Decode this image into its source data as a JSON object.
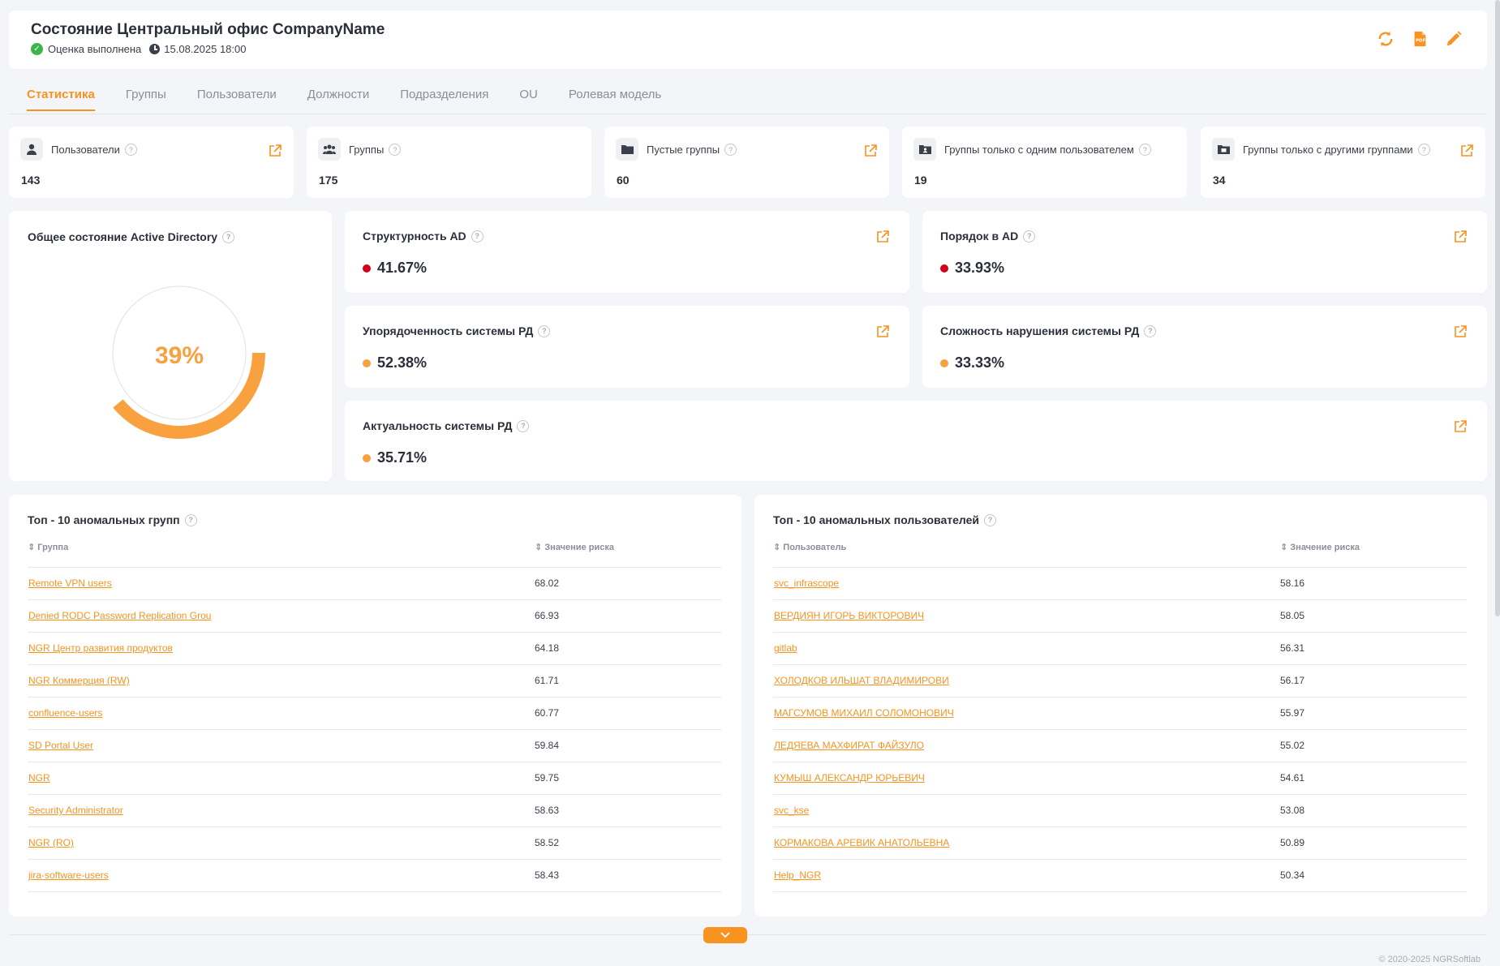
{
  "header": {
    "title": "Состояние Центральный офис CompanyName",
    "status": "Оценка выполнена",
    "datetime": "15.08.2025 18:00",
    "icons": [
      "refresh-icon",
      "pdf-export-icon",
      "edit-icon"
    ]
  },
  "tabs": [
    {
      "label": "Статистика",
      "active": true
    },
    {
      "label": "Группы"
    },
    {
      "label": "Пользователи"
    },
    {
      "label": "Должности"
    },
    {
      "label": "Подразделения"
    },
    {
      "label": "OU"
    },
    {
      "label": "Ролевая модель"
    }
  ],
  "stats": [
    {
      "label": "Пользователи",
      "value": "143",
      "icon": "user-icon",
      "link": true
    },
    {
      "label": "Группы",
      "value": "175",
      "icon": "group-icon",
      "link": false
    },
    {
      "label": "Пустые группы",
      "value": "60",
      "icon": "folder-icon",
      "link": true
    },
    {
      "label": "Группы только с одним пользователем",
      "value": "19",
      "icon": "folder-user-icon",
      "link": false
    },
    {
      "label": "Группы только с другими группами",
      "value": "34",
      "icon": "folder-group-icon",
      "link": true
    }
  ],
  "overall": {
    "title": "Общее состояние Active Directory",
    "value": "39%",
    "fraction": 0.39,
    "color": "#f9a03f"
  },
  "metrics": {
    "structure": {
      "title": "Структурность AD",
      "value": "41.67%",
      "status_color": "#d0021b"
    },
    "order": {
      "title": "Порядок в AD",
      "value": "33.93%",
      "status_color": "#d0021b"
    },
    "rd_order": {
      "title": "Упорядоченность системы РД",
      "value": "52.38%",
      "status_color": "#f9a03f"
    },
    "rd_violation": {
      "title": "Сложность нарушения системы РД",
      "value": "33.33%",
      "status_color": "#f9a03f"
    },
    "rd_actuality": {
      "title": "Актуальность системы РД",
      "value": "35.71%",
      "status_color": "#f9a03f"
    }
  },
  "top_groups": {
    "title": "Топ - 10 аномальных групп",
    "columns": [
      "Группа",
      "Значение риска"
    ],
    "rows": [
      [
        "Remote VPN users",
        "68.02"
      ],
      [
        "Denied RODC Password Replication Grou",
        "66.93"
      ],
      [
        "NGR Центр развития продуктов",
        "64.18"
      ],
      [
        "NGR Коммерция (RW)",
        "61.71"
      ],
      [
        "confluence-users",
        "60.77"
      ],
      [
        "SD Portal User",
        "59.84"
      ],
      [
        "NGR",
        "59.75"
      ],
      [
        "Security Administrator",
        "58.63"
      ],
      [
        "NGR (RO)",
        "58.52"
      ],
      [
        "jira-software-users",
        "58.43"
      ]
    ]
  },
  "top_users": {
    "title": "Топ - 10 аномальных пользователей",
    "columns": [
      "Пользователь",
      "Значение риска"
    ],
    "rows": [
      [
        "svc_infrascope",
        "58.16"
      ],
      [
        "ВЕРДИЯН ИГОРЬ ВИКТОРОВИЧ",
        "58.05"
      ],
      [
        "gitlab",
        "56.31"
      ],
      [
        "ХОЛОДКОВ ИЛЬШАТ ВЛАДИМИРОВИ",
        "56.17"
      ],
      [
        "МАГСУМОВ МИХАИЛ СОЛОМОНОВИЧ",
        "55.97"
      ],
      [
        "ЛЕДЯЕВА МАХФИРАТ ФАЙЗУЛО",
        "55.02"
      ],
      [
        "КУМЫШ АЛЕКСАНДР ЮРЬЕВИЧ",
        "54.61"
      ],
      [
        "svc_kse",
        "53.08"
      ],
      [
        "КОРМАКОВА АРЕВИК АНАТОЛЬЕВНА",
        "50.89"
      ],
      [
        "Help_NGR",
        "50.34"
      ]
    ]
  },
  "footer": "© 2020-2025 NGRSoftlab",
  "colors": {
    "accent": "#f7931e",
    "danger": "#d0021b",
    "success": "#3bb54a"
  }
}
